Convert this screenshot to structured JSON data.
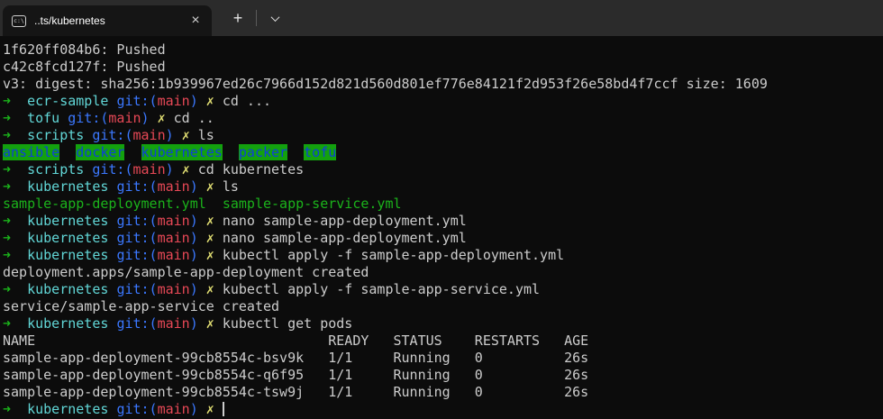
{
  "colors": {
    "terminal_bg": "#0c0c0c",
    "tab_bar_bg": "#2b2b2b",
    "tab_bg": "#151515",
    "fg": "#cccccc",
    "green": "#1bb31b",
    "cyan": "#61d6d6",
    "blue": "#3b78ff",
    "red": "#e74856",
    "yellow": "#e2df73",
    "dirfg": "#0f3fd8",
    "dirbg": "#13a10e",
    "cursor": "#cccccc"
  },
  "tabbar": {
    "tab_title": "..ts/kubernetes",
    "tab_icon_text": "c:\\",
    "close_glyph": "×",
    "new_tab_glyph": "+"
  },
  "terminal": {
    "lines": [
      {
        "segments": [
          {
            "t": "1f620ff084b6: Pushed",
            "c": "fg"
          }
        ]
      },
      {
        "segments": [
          {
            "t": "c42c8fcd127f: Pushed",
            "c": "fg"
          }
        ]
      },
      {
        "segments": [
          {
            "t": "v3: digest: sha256:1b939967ed26c7966d152d821d560d801ef776e84121f2d953f26e58bd4f7ccf size: 1609",
            "c": "fg"
          }
        ]
      },
      {
        "segments": [
          {
            "t": "➜",
            "c": "green"
          },
          {
            "t": "  ",
            "c": "fg"
          },
          {
            "t": "ecr-sample",
            "c": "cyan"
          },
          {
            "t": " ",
            "c": "fg"
          },
          {
            "t": "git:(",
            "c": "blue"
          },
          {
            "t": "main",
            "c": "red"
          },
          {
            "t": ")",
            "c": "blue"
          },
          {
            "t": " ",
            "c": "fg"
          },
          {
            "t": "✗",
            "c": "yellow"
          },
          {
            "t": " cd ...",
            "c": "fg"
          }
        ]
      },
      {
        "segments": [
          {
            "t": "➜",
            "c": "green"
          },
          {
            "t": "  ",
            "c": "fg"
          },
          {
            "t": "tofu",
            "c": "cyan"
          },
          {
            "t": " ",
            "c": "fg"
          },
          {
            "t": "git:(",
            "c": "blue"
          },
          {
            "t": "main",
            "c": "red"
          },
          {
            "t": ")",
            "c": "blue"
          },
          {
            "t": " ",
            "c": "fg"
          },
          {
            "t": "✗",
            "c": "yellow"
          },
          {
            "t": " cd ..",
            "c": "fg"
          }
        ]
      },
      {
        "segments": [
          {
            "t": "➜",
            "c": "green"
          },
          {
            "t": "  ",
            "c": "fg"
          },
          {
            "t": "scripts",
            "c": "cyan"
          },
          {
            "t": " ",
            "c": "fg"
          },
          {
            "t": "git:(",
            "c": "blue"
          },
          {
            "t": "main",
            "c": "red"
          },
          {
            "t": ")",
            "c": "blue"
          },
          {
            "t": " ",
            "c": "fg"
          },
          {
            "t": "✗",
            "c": "yellow"
          },
          {
            "t": " ls",
            "c": "fg"
          }
        ]
      },
      {
        "segments": [
          {
            "t": "ansible",
            "c": "dir"
          },
          {
            "t": "  ",
            "c": "fg"
          },
          {
            "t": "docker",
            "c": "dir"
          },
          {
            "t": "  ",
            "c": "fg"
          },
          {
            "t": "kubernetes",
            "c": "dir"
          },
          {
            "t": "  ",
            "c": "fg"
          },
          {
            "t": "packer",
            "c": "dir"
          },
          {
            "t": "  ",
            "c": "fg"
          },
          {
            "t": "tofu",
            "c": "dir"
          }
        ]
      },
      {
        "segments": [
          {
            "t": "➜",
            "c": "green"
          },
          {
            "t": "  ",
            "c": "fg"
          },
          {
            "t": "scripts",
            "c": "cyan"
          },
          {
            "t": " ",
            "c": "fg"
          },
          {
            "t": "git:(",
            "c": "blue"
          },
          {
            "t": "main",
            "c": "red"
          },
          {
            "t": ")",
            "c": "blue"
          },
          {
            "t": " ",
            "c": "fg"
          },
          {
            "t": "✗",
            "c": "yellow"
          },
          {
            "t": " cd kubernetes",
            "c": "fg"
          }
        ]
      },
      {
        "segments": [
          {
            "t": "➜",
            "c": "green"
          },
          {
            "t": "  ",
            "c": "fg"
          },
          {
            "t": "kubernetes",
            "c": "cyan"
          },
          {
            "t": " ",
            "c": "fg"
          },
          {
            "t": "git:(",
            "c": "blue"
          },
          {
            "t": "main",
            "c": "red"
          },
          {
            "t": ")",
            "c": "blue"
          },
          {
            "t": " ",
            "c": "fg"
          },
          {
            "t": "✗",
            "c": "yellow"
          },
          {
            "t": " ls",
            "c": "fg"
          }
        ]
      },
      {
        "segments": [
          {
            "t": "sample-app-deployment.yml  sample-app-service.yml",
            "c": "green"
          }
        ]
      },
      {
        "segments": [
          {
            "t": "➜",
            "c": "green"
          },
          {
            "t": "  ",
            "c": "fg"
          },
          {
            "t": "kubernetes",
            "c": "cyan"
          },
          {
            "t": " ",
            "c": "fg"
          },
          {
            "t": "git:(",
            "c": "blue"
          },
          {
            "t": "main",
            "c": "red"
          },
          {
            "t": ")",
            "c": "blue"
          },
          {
            "t": " ",
            "c": "fg"
          },
          {
            "t": "✗",
            "c": "yellow"
          },
          {
            "t": " nano sample-app-deployment.yml",
            "c": "fg"
          }
        ]
      },
      {
        "segments": [
          {
            "t": "➜",
            "c": "green"
          },
          {
            "t": "  ",
            "c": "fg"
          },
          {
            "t": "kubernetes",
            "c": "cyan"
          },
          {
            "t": " ",
            "c": "fg"
          },
          {
            "t": "git:(",
            "c": "blue"
          },
          {
            "t": "main",
            "c": "red"
          },
          {
            "t": ")",
            "c": "blue"
          },
          {
            "t": " ",
            "c": "fg"
          },
          {
            "t": "✗",
            "c": "yellow"
          },
          {
            "t": " nano sample-app-deployment.yml",
            "c": "fg"
          }
        ]
      },
      {
        "segments": [
          {
            "t": "➜",
            "c": "green"
          },
          {
            "t": "  ",
            "c": "fg"
          },
          {
            "t": "kubernetes",
            "c": "cyan"
          },
          {
            "t": " ",
            "c": "fg"
          },
          {
            "t": "git:(",
            "c": "blue"
          },
          {
            "t": "main",
            "c": "red"
          },
          {
            "t": ")",
            "c": "blue"
          },
          {
            "t": " ",
            "c": "fg"
          },
          {
            "t": "✗",
            "c": "yellow"
          },
          {
            "t": " kubectl apply -f sample-app-deployment.yml",
            "c": "fg"
          }
        ]
      },
      {
        "segments": [
          {
            "t": "deployment.apps/sample-app-deployment created",
            "c": "fg"
          }
        ]
      },
      {
        "segments": [
          {
            "t": "➜",
            "c": "green"
          },
          {
            "t": "  ",
            "c": "fg"
          },
          {
            "t": "kubernetes",
            "c": "cyan"
          },
          {
            "t": " ",
            "c": "fg"
          },
          {
            "t": "git:(",
            "c": "blue"
          },
          {
            "t": "main",
            "c": "red"
          },
          {
            "t": ")",
            "c": "blue"
          },
          {
            "t": " ",
            "c": "fg"
          },
          {
            "t": "✗",
            "c": "yellow"
          },
          {
            "t": " kubectl apply -f sample-app-service.yml",
            "c": "fg"
          }
        ]
      },
      {
        "segments": [
          {
            "t": "service/sample-app-service created",
            "c": "fg"
          }
        ]
      },
      {
        "segments": [
          {
            "t": "➜",
            "c": "green"
          },
          {
            "t": "  ",
            "c": "fg"
          },
          {
            "t": "kubernetes",
            "c": "cyan"
          },
          {
            "t": " ",
            "c": "fg"
          },
          {
            "t": "git:(",
            "c": "blue"
          },
          {
            "t": "main",
            "c": "red"
          },
          {
            "t": ")",
            "c": "blue"
          },
          {
            "t": " ",
            "c": "fg"
          },
          {
            "t": "✗",
            "c": "yellow"
          },
          {
            "t": " kubectl get pods",
            "c": "fg"
          }
        ]
      },
      {
        "segments": [
          {
            "t": "NAME                                    READY   STATUS    RESTARTS   AGE",
            "c": "fg"
          }
        ]
      },
      {
        "segments": [
          {
            "t": "sample-app-deployment-99cb8554c-bsv9k   1/1     Running   0          26s",
            "c": "fg"
          }
        ]
      },
      {
        "segments": [
          {
            "t": "sample-app-deployment-99cb8554c-q6f95   1/1     Running   0          26s",
            "c": "fg"
          }
        ]
      },
      {
        "segments": [
          {
            "t": "sample-app-deployment-99cb8554c-tsw9j   1/1     Running   0          26s",
            "c": "fg"
          }
        ]
      },
      {
        "segments": [
          {
            "t": "➜",
            "c": "green"
          },
          {
            "t": "  ",
            "c": "fg"
          },
          {
            "t": "kubernetes",
            "c": "cyan"
          },
          {
            "t": " ",
            "c": "fg"
          },
          {
            "t": "git:(",
            "c": "blue"
          },
          {
            "t": "main",
            "c": "red"
          },
          {
            "t": ")",
            "c": "blue"
          },
          {
            "t": " ",
            "c": "fg"
          },
          {
            "t": "✗",
            "c": "yellow"
          },
          {
            "t": " ",
            "c": "fg"
          }
        ],
        "cursor": true
      }
    ]
  }
}
